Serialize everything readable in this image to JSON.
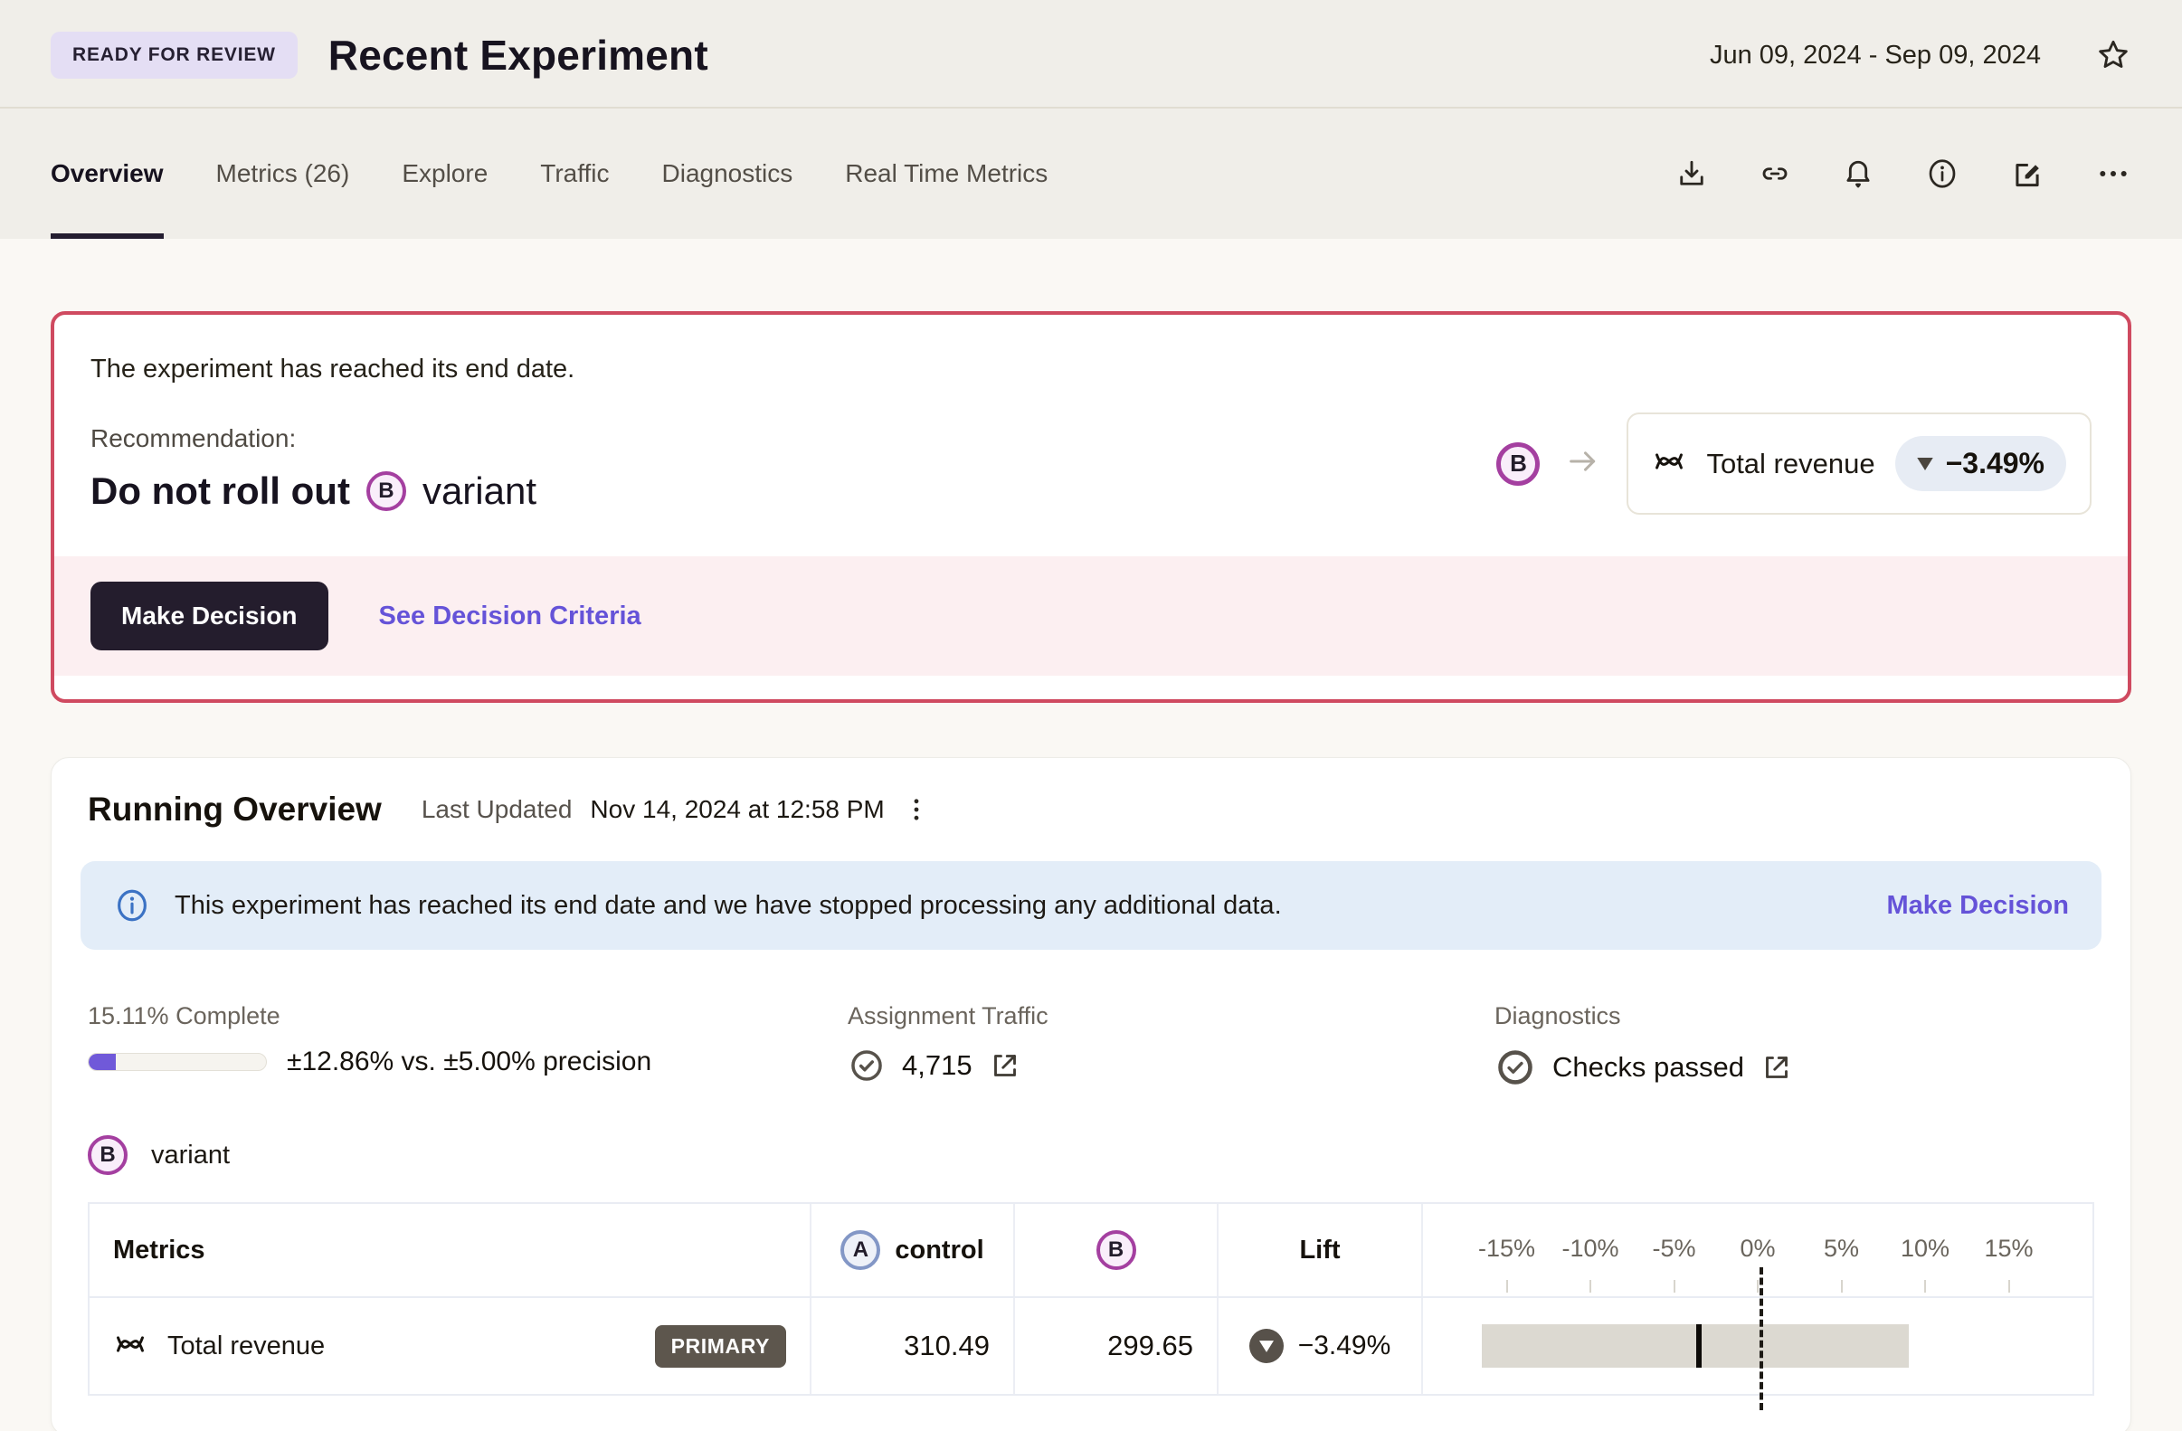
{
  "header": {
    "status_badge": "READY FOR REVIEW",
    "title": "Recent Experiment",
    "date_range": "Jun 09, 2024 - Sep 09, 2024"
  },
  "tabs": [
    {
      "label": "Overview"
    },
    {
      "label": "Metrics (26)"
    },
    {
      "label": "Explore"
    },
    {
      "label": "Traffic"
    },
    {
      "label": "Diagnostics"
    },
    {
      "label": "Real Time Metrics"
    }
  ],
  "toolbar_icons": [
    "download-icon",
    "link-icon",
    "bell-icon",
    "info-icon",
    "edit-icon",
    "more-icon",
    "star-icon"
  ],
  "recommendation": {
    "end_date_text": "The experiment has reached its end date.",
    "label": "Recommendation:",
    "action_bold": "Do not roll out",
    "variant_badge": "B",
    "variant_word": "variant",
    "metric_name": "Total revenue",
    "metric_delta": "−3.49%",
    "make_decision_label": "Make Decision",
    "criteria_link": "See Decision Criteria"
  },
  "overview": {
    "title": "Running Overview",
    "last_updated_label": "Last Updated",
    "last_updated_value": "Nov 14, 2024 at 12:58 PM",
    "banner": {
      "text": "This experiment has reached its end date and we have stopped processing any additional data.",
      "link": "Make Decision"
    },
    "progress": {
      "label": "15.11% Complete",
      "percent": 15.11,
      "precision_text": "±12.86% vs. ±5.00% precision"
    },
    "assignment_traffic": {
      "label": "Assignment Traffic",
      "value": "4,715"
    },
    "diagnostics": {
      "label": "Diagnostics",
      "value": "Checks passed"
    },
    "variant_row": {
      "badge": "B",
      "label": "variant"
    }
  },
  "table": {
    "headers": {
      "metrics": "Metrics",
      "control_badge": "A",
      "control_label": "control",
      "variant_badge": "B",
      "lift": "Lift"
    },
    "axis": {
      "min": -20,
      "max": 20,
      "tick_values": [
        -15,
        -10,
        -5,
        0,
        5,
        10,
        15
      ],
      "tick_labels": [
        "-15%",
        "-10%",
        "-5%",
        "0%",
        "5%",
        "10%",
        "15%"
      ]
    },
    "rows": [
      {
        "name": "Total revenue",
        "tag": "PRIMARY",
        "control": "310.49",
        "variant": "299.65",
        "lift": "−3.49%",
        "lift_direction": "down",
        "ci_low": -16.5,
        "ci_high": 9.0,
        "point": -3.49
      }
    ]
  },
  "colors": {
    "accent_purple": "#6553d8",
    "variant_ring": "#a43fa0",
    "control_ring": "#8397c6",
    "alert_border": "#cf4a60",
    "alert_footer_bg": "#fceff1",
    "banner_bg": "#e3edf8",
    "progress_fill": "#7059d9",
    "ci_bar": "#dcd9d1",
    "header_bg": "#f0eee9",
    "page_bg": "#faf8f4"
  }
}
